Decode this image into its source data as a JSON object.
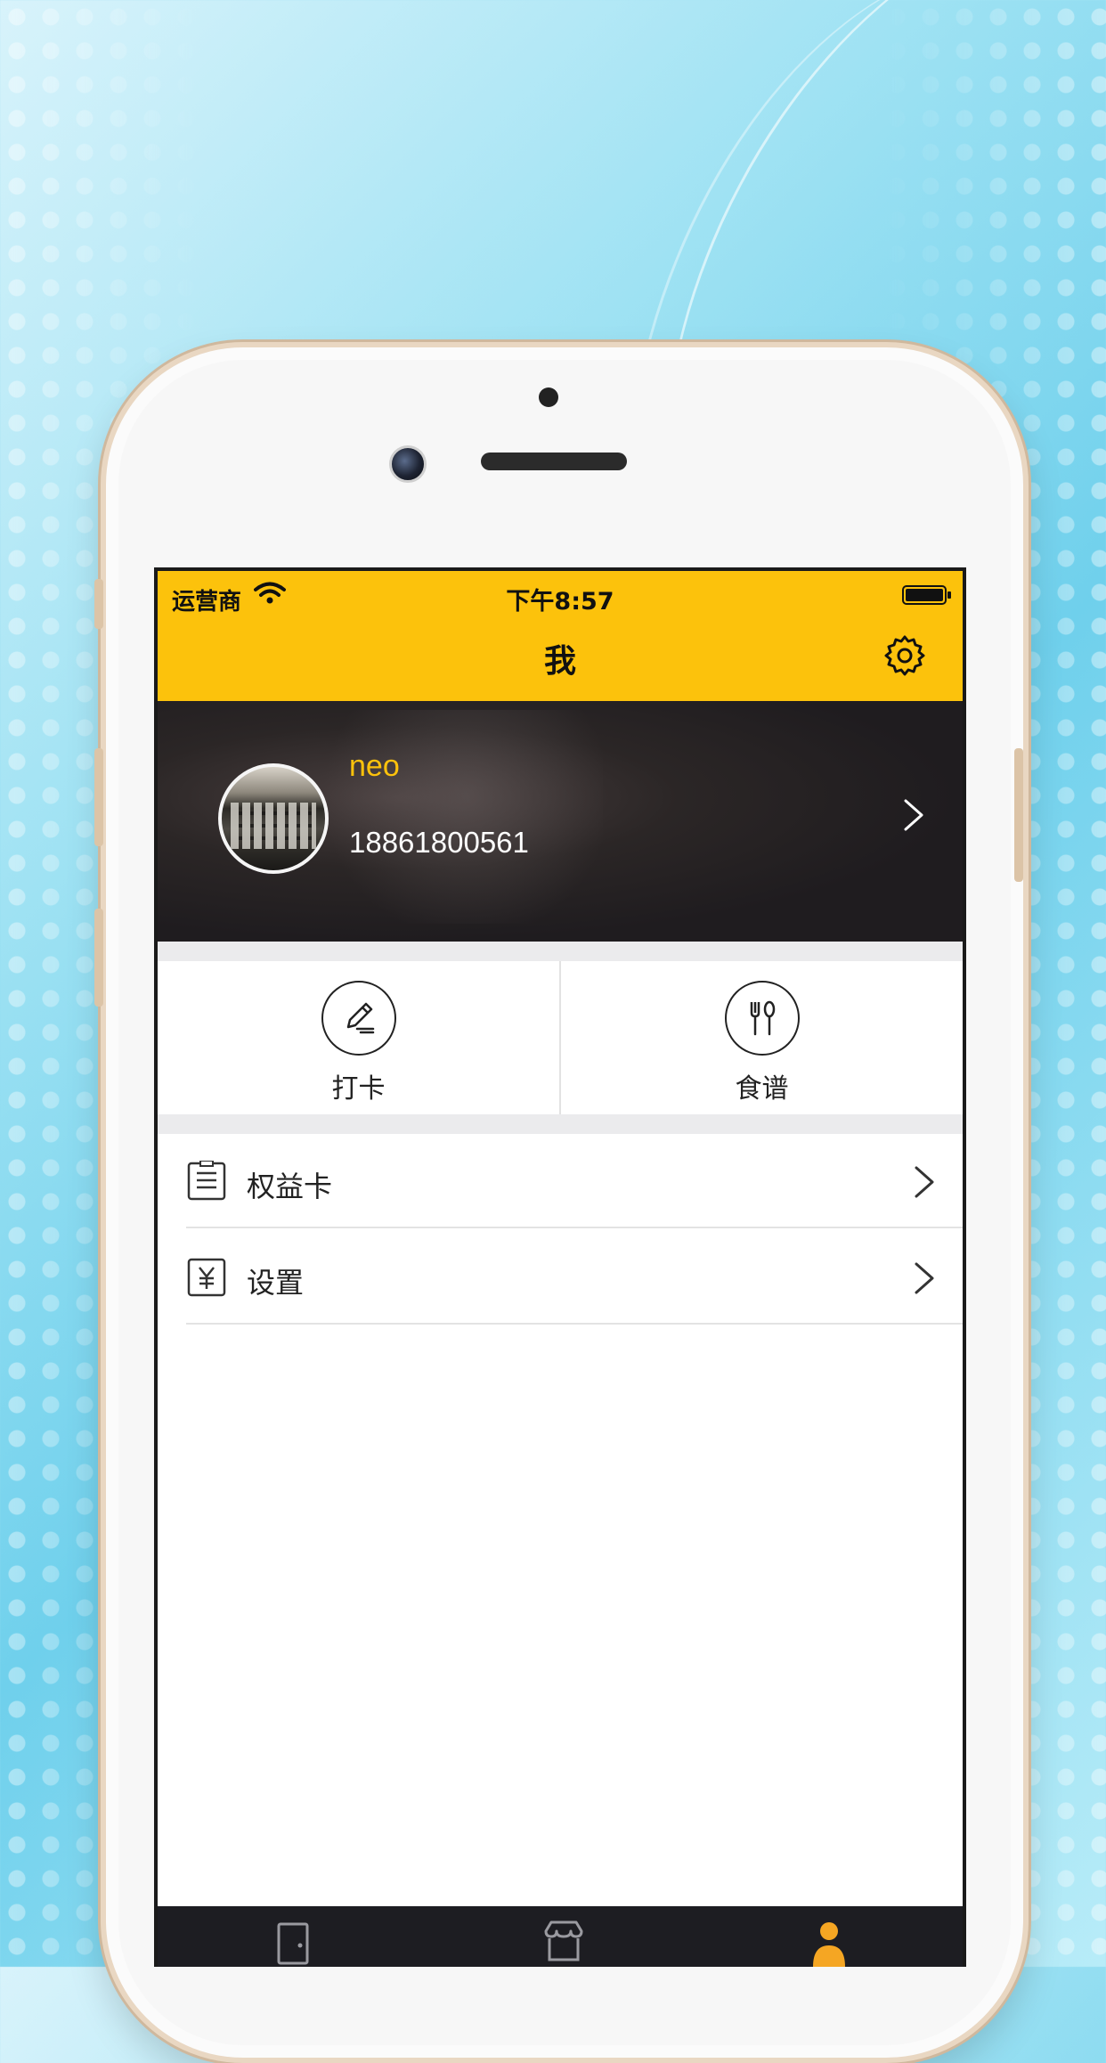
{
  "status_bar": {
    "carrier": "运营商",
    "time": "下午8:57"
  },
  "header": {
    "title": "我"
  },
  "profile": {
    "name": "neo",
    "phone": "18861800561"
  },
  "quick_actions": [
    {
      "label": "打卡",
      "icon": "pencil-circle-icon"
    },
    {
      "label": "食谱",
      "icon": "fork-spoon-circle-icon"
    }
  ],
  "menu": [
    {
      "label": "权益卡",
      "icon": "list-card-icon"
    },
    {
      "label": "设置",
      "icon": "yuan-card-icon"
    }
  ],
  "tabbar": {
    "tabs": [
      {
        "icon": "door-icon",
        "active": false
      },
      {
        "icon": "store-icon",
        "active": false
      },
      {
        "icon": "user-icon",
        "active": true
      }
    ]
  },
  "colors": {
    "accent": "#fcc20c",
    "tab_active": "#f5a623"
  }
}
